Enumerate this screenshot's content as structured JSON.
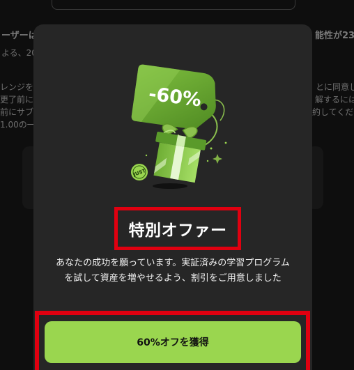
{
  "background": {
    "lines": [
      "ーザーは",
      "能性が23",
      "よる、20",
      "レンジを継",
      "とに同意し",
      "更了前に解",
      "解するには",
      "前にサブス",
      "約してくださ",
      "1.00の一"
    ]
  },
  "modal": {
    "discount_tag": "-60%",
    "badge_text": "JUST",
    "title": "特別オファー",
    "description": "あなたの成功を願っています。実証済みの学習プログラムを試して資産を増やせるよう、割引をご用意しました",
    "cta_label": "60%オフを獲得"
  },
  "colors": {
    "accent_green": "#9ad64f",
    "modal_bg": "#262626",
    "highlight_red": "#e00010"
  }
}
